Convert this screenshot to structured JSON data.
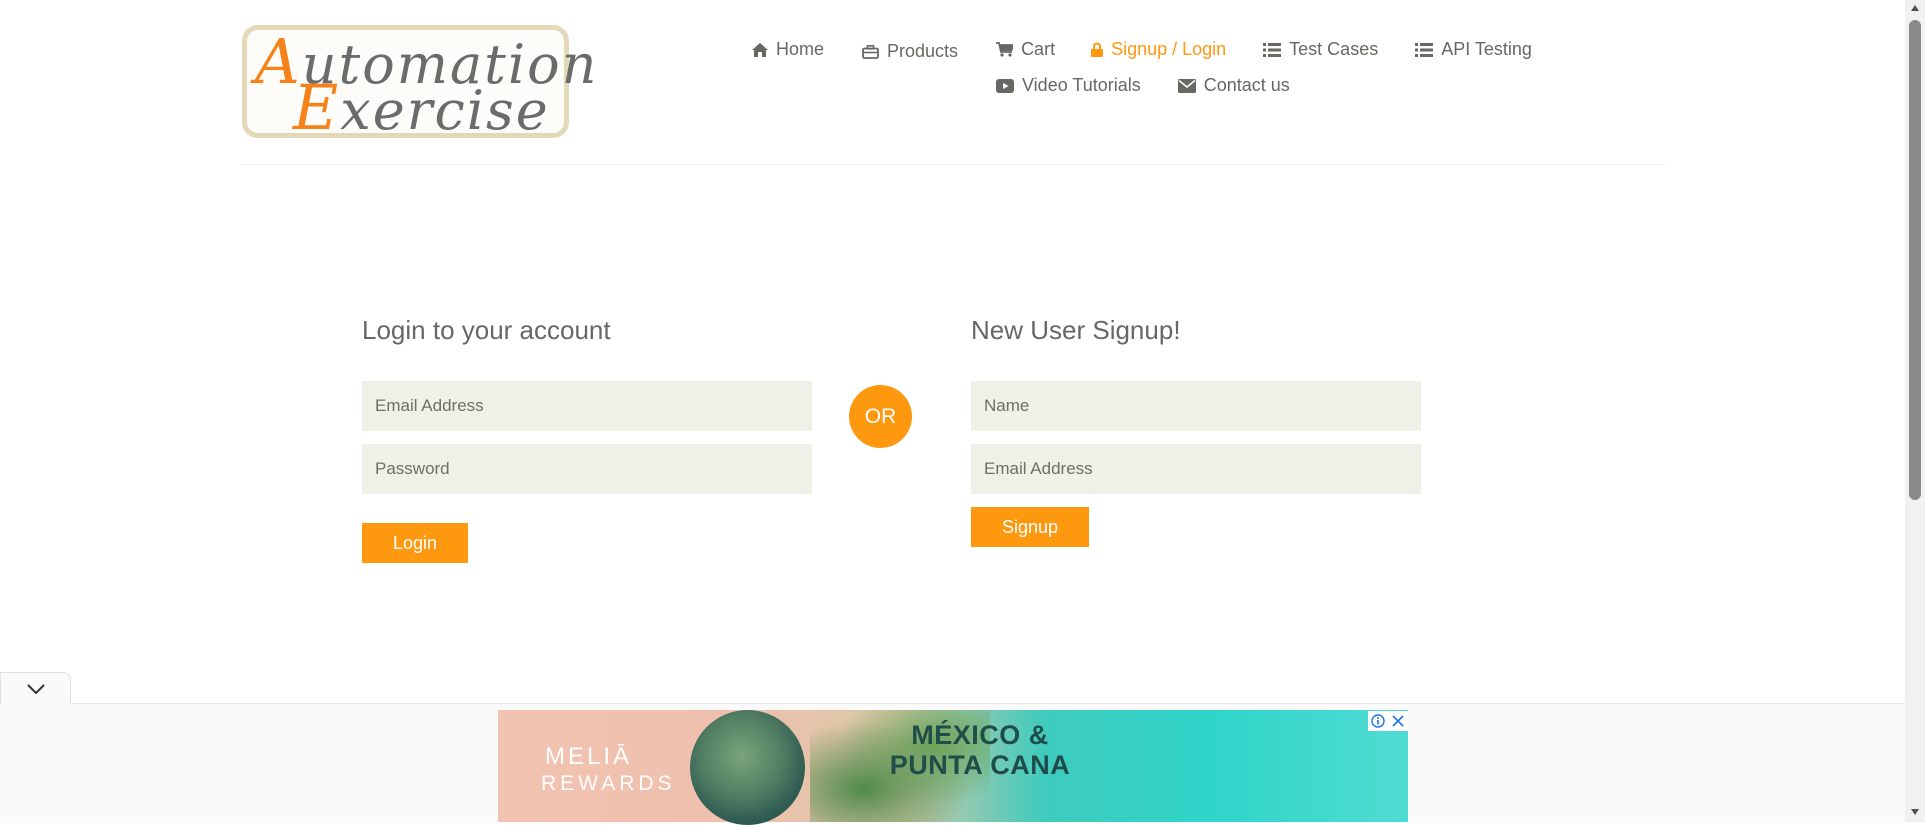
{
  "logo": {
    "line1_cap": "A",
    "line1_rest": "utomation",
    "line2_cap": "E",
    "line2_rest": "xercise"
  },
  "nav": {
    "items": [
      {
        "label": "Home",
        "icon": "home-icon"
      },
      {
        "label": "Products",
        "icon": "briefcase-icon"
      },
      {
        "label": "Cart",
        "icon": "cart-icon"
      },
      {
        "label": "Signup / Login",
        "icon": "lock-icon",
        "active": true
      },
      {
        "label": "Test Cases",
        "icon": "list-icon"
      },
      {
        "label": "API Testing",
        "icon": "list-icon"
      },
      {
        "label": "Video Tutorials",
        "icon": "youtube-play-icon"
      },
      {
        "label": "Contact us",
        "icon": "envelope-icon"
      }
    ]
  },
  "login": {
    "title": "Login to your account",
    "email_placeholder": "Email Address",
    "password_placeholder": "Password",
    "button": "Login"
  },
  "or_label": "OR",
  "signup": {
    "title": "New User Signup!",
    "name_placeholder": "Name",
    "email_placeholder": "Email Address",
    "button": "Signup"
  },
  "ad": {
    "brand": "MELIĀ",
    "brand_sub": "REWARDS",
    "headline": "MÉXICO & PUNTA CANA"
  },
  "colors": {
    "accent": "#fe980f",
    "text": "#696763",
    "field_bg": "#f0f0e9"
  }
}
